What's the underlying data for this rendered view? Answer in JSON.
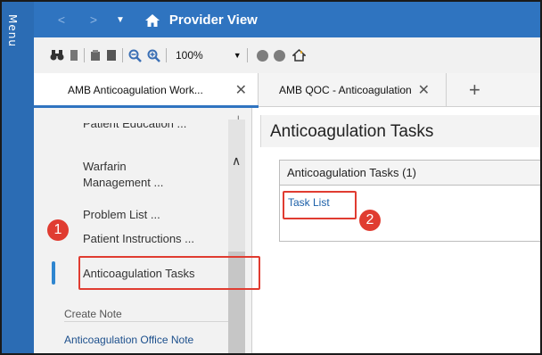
{
  "menu_strip": {
    "label": "Menu"
  },
  "titlebar": {
    "title": "Provider View",
    "icons": [
      "back-arrow-icon",
      "forward-arrow-icon",
      "dropdown-caret-icon",
      "home-icon"
    ]
  },
  "toolbar": {
    "zoom": "100%",
    "icons": [
      "binoculars-icon",
      "page-icon",
      "print-icon",
      "print-preview-icon",
      "zoom-out-icon",
      "zoom-in-icon",
      "circle-icon",
      "circle-icon",
      "house-icon"
    ]
  },
  "tabs": [
    {
      "label": "AMB Anticoagulation Work...",
      "active": true
    },
    {
      "label": "AMB QOC - Anticoagulation",
      "active": false
    }
  ],
  "tab_close": "✕",
  "tab_add": "+",
  "left_nav": {
    "partial_item": "Patient Education ...",
    "items": [
      {
        "label": "Warfarin"
      },
      {
        "label": "Management ..."
      },
      {
        "label": "Problem List ..."
      },
      {
        "label": "Patient Instructions ..."
      },
      {
        "label": "Anticoagulation Tasks",
        "selected": true
      }
    ],
    "create_note_header": "Create Note",
    "note_link": "Anticoagulation Office Note"
  },
  "main": {
    "title": "Anticoagulation Tasks",
    "panel_header": "Anticoagulation Tasks (1)",
    "link": "Task List"
  },
  "callouts": [
    "1",
    "2"
  ],
  "colors": {
    "title_bar": "#2f74c0",
    "menu_strip": "#2b6cb4",
    "highlight": "#e03c31",
    "link": "#1b5fa8",
    "active_indicator": "#2f86d0"
  }
}
